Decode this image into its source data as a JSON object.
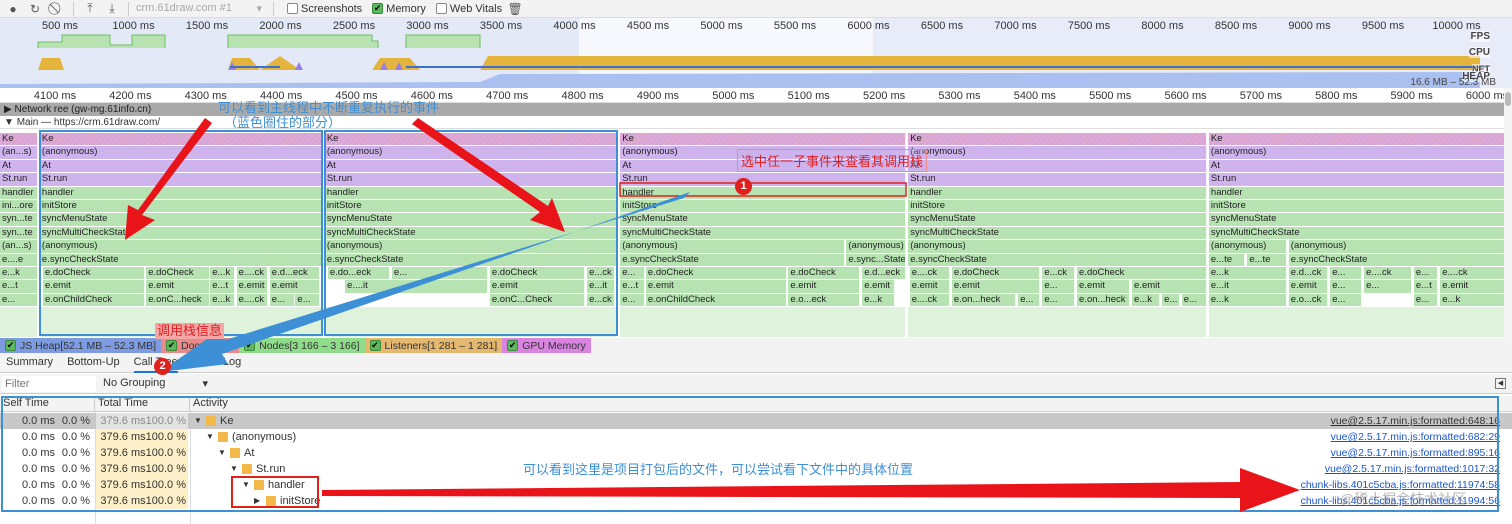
{
  "toolbar": {
    "icons": [
      "record-icon",
      "reload-icon",
      "clear-icon",
      "upload-icon",
      "download-icon"
    ],
    "target": "crm.61draw.com #1",
    "screenshots_label": "Screenshots",
    "screenshots_checked": false,
    "memory_label": "Memory",
    "memory_checked": true,
    "webvitals_label": "Web Vitals",
    "webvitals_checked": false
  },
  "overview": {
    "ticks": [
      "500 ms",
      "1000 ms",
      "1500 ms",
      "2000 ms",
      "2500 ms",
      "3000 ms",
      "3500 ms",
      "4000 ms",
      "4500 ms",
      "5000 ms",
      "5500 ms",
      "6000 ms",
      "6500 ms",
      "7000 ms",
      "7500 ms",
      "8000 ms",
      "8500 ms",
      "9000 ms",
      "9500 ms",
      "10000 ms"
    ],
    "tick_ms": [
      500,
      1000,
      1500,
      2000,
      2500,
      3000,
      3500,
      4000,
      4500,
      5000,
      5500,
      6000,
      6500,
      7000,
      7500,
      8000,
      8500,
      9000,
      9500,
      10000
    ],
    "labels": {
      "fps": "FPS",
      "cpu": "CPU",
      "net": "NET",
      "heap": "HEAP"
    },
    "heap_range": "16.6 MB – 52.3 MB",
    "selection_ms": [
      4030,
      6030
    ],
    "colors": {
      "fps": "#b8e3b0",
      "cpu_scripting": "#e4b43c",
      "cpu_rendering": "#9b7ee0",
      "net": "#3d6fd0",
      "heap": "#a9c0f0"
    }
  },
  "ruler": {
    "ticks": [
      "4100 ms",
      "4200 ms",
      "4300 ms",
      "4400 ms",
      "4500 ms",
      "4600 ms",
      "4700 ms",
      "4800 ms",
      "4900 ms",
      "5000 ms",
      "5100 ms",
      "5200 ms",
      "5300 ms",
      "5400 ms",
      "5500 ms",
      "5600 ms",
      "5700 ms",
      "5800 ms",
      "5900 ms",
      "6000 ms"
    ],
    "tick_ms": [
      4100,
      4200,
      4300,
      4400,
      4500,
      4600,
      4700,
      4800,
      4900,
      5000,
      5100,
      5200,
      5300,
      5400,
      5500,
      5600,
      5700,
      5800,
      5900,
      6000
    ]
  },
  "tracks": {
    "network": "Network ree (gw-mg.61info.cn)",
    "main": "Main — https://crm.61draw.com/"
  },
  "flame": {
    "groups": [
      {
        "start": 4027,
        "end": 4078,
        "rows": [
          "Ke",
          "(an...s)",
          "At",
          "St.run",
          "handler",
          "ini...ore",
          "syn...te",
          "syn...te",
          "(an...s)",
          "e....e"
        ],
        "lower": [
          [
            [
              "e...k",
              4027,
              4078
            ]
          ],
          [
            [
              "e...t",
              4027,
              4078
            ]
          ],
          [
            [
              "e...",
              4027,
              4078
            ]
          ]
        ]
      },
      {
        "start": 4080,
        "end": 4454,
        "rows": [
          "Ke",
          "(anonymous)",
          "At",
          "St.run",
          "handler",
          "initStore",
          "syncMenuState",
          "syncMultiCheckState",
          "(anonymous)",
          "e.syncCheckState"
        ],
        "lower": [
          [
            [
              "e.doCheck",
              4084,
              4219
            ],
            [
              "e.doCheck",
              4221,
              4306
            ],
            [
              "e...k",
              4306,
              4339
            ],
            [
              "e....ck",
              4341,
              4383
            ],
            [
              "e.d...eck",
              4385,
              4452
            ]
          ],
          [
            [
              "e.emit",
              4084,
              4219
            ],
            [
              "e.emit",
              4221,
              4306
            ],
            [
              "e...t",
              4306,
              4339
            ],
            [
              "e.emit",
              4341,
              4383
            ],
            [
              "e.emit",
              4385,
              4452
            ]
          ],
          [
            [
              "e.onChildCheck",
              4084,
              4219
            ],
            [
              "e.onC...heck",
              4221,
              4306
            ],
            [
              "e...k",
              4306,
              4339
            ],
            [
              "e....ck",
              4341,
              4383
            ],
            [
              "e...",
              4385,
              4418
            ],
            [
              "e...",
              4419,
              4452
            ]
          ]
        ]
      },
      {
        "start": 4458,
        "end": 4846,
        "rows": [
          "Ke",
          "(anonymous)",
          "At",
          "St.run",
          "handler",
          "initStore",
          "syncMenuState",
          "syncMultiCheckState",
          "(anonymous)",
          "e.syncCheckState"
        ],
        "lower": [
          [
            [
              "e.do...eck",
              4462,
              4544
            ],
            [
              "e...",
              4547,
              4674
            ],
            [
              "e.doCheck",
              4677,
              4803
            ],
            [
              "e...ck",
              4806,
              4843
            ]
          ],
          [
            [
              "e....it",
              4485,
              4674
            ],
            [
              "e.emit",
              4677,
              4803
            ],
            [
              "e...it",
              4806,
              4843
            ]
          ],
          [
            [
              "e.onC...Check",
              4677,
              4803
            ],
            [
              "e...ck",
              4806,
              4843
            ]
          ]
        ]
      },
      {
        "start": 4850,
        "end": 5229,
        "rows": [
          "Ke",
          "(anonymous)",
          "At",
          "St.run",
          "handler",
          "initStore",
          "syncMenuState",
          "syncMultiCheckState"
        ],
        "mid": [
          [
            [
              "(anonymous)",
              4850,
              5148
            ],
            [
              "(anonymous)",
              5150,
              5229
            ]
          ],
          [
            [
              "e.syncCheckState",
              4850,
              5148
            ],
            [
              "e.sync...State",
              5150,
              5229
            ]
          ]
        ],
        "lower": [
          [
            [
              "e...",
              4850,
              4883
            ],
            [
              "e.doCheck",
              4884,
              5071
            ],
            [
              "e.doCheck",
              5073,
              5168
            ],
            [
              "e.d...eck",
              5171,
              5229
            ]
          ],
          [
            [
              "e...t",
              4850,
              4883
            ],
            [
              "e.emit",
              4884,
              5071
            ],
            [
              "e.emit",
              5073,
              5168
            ],
            [
              "e.emit",
              5171,
              5215
            ]
          ],
          [
            [
              "e...",
              4850,
              4883
            ],
            [
              "e.onChildCheck",
              4884,
              5071
            ],
            [
              "e.o...eck",
              5073,
              5168
            ],
            [
              "e...k",
              5171,
              5215
            ]
          ]
        ]
      },
      {
        "start": 5232,
        "end": 5628,
        "rows": [
          "Ke",
          "(anonymous)",
          "At",
          "St.run",
          "handler",
          "initStore",
          "syncMenuState",
          "syncMultiCheckState",
          "(anonymous)",
          "e.syncCheckState"
        ],
        "lower": [
          [
            [
              "e....ck",
              5234,
              5287
            ],
            [
              "e.doCheck",
              5290,
              5407
            ],
            [
              "e...ck",
              5410,
              5453
            ],
            [
              "e.doCheck",
              5456,
              5628
            ]
          ],
          [
            [
              "e.emit",
              5234,
              5287
            ],
            [
              "e.emit",
              5290,
              5407
            ],
            [
              "e...",
              5410,
              5453
            ],
            [
              "e.emit",
              5456,
              5526
            ],
            [
              "e.emit",
              5529,
              5628
            ]
          ],
          [
            [
              "e....ck",
              5234,
              5287
            ],
            [
              "e.on...heck",
              5290,
              5375
            ],
            [
              "e...",
              5378,
              5407
            ],
            [
              "e...",
              5410,
              5453
            ],
            [
              "e.on...heck",
              5456,
              5526
            ],
            [
              "e...k",
              5529,
              5566
            ],
            [
              "e...",
              5569,
              5593
            ],
            [
              "e...",
              5595,
              5628
            ]
          ]
        ]
      },
      {
        "start": 5631,
        "end": 6033,
        "rows": [
          "Ke",
          "(anonymous)",
          "At",
          "St.run",
          "handler",
          "initStore",
          "syncMenuState",
          "syncMultiCheckState"
        ],
        "mid": [
          [
            [
              "(anonymous)",
              5631,
              5735
            ],
            [
              "(anonymous)",
              5737,
              6033
            ]
          ],
          [
            [
              "e...te",
              5631,
              5679
            ],
            [
              "e...te",
              5682,
              5735
            ],
            [
              "e.syncCheckState",
              5737,
              6033
            ]
          ]
        ],
        "lower": [
          [
            [
              "e...k",
              5631,
              5735
            ],
            [
              "e.d...ck",
              5737,
              5789
            ],
            [
              "e...",
              5792,
              5834
            ],
            [
              "e....ck",
              5837,
              5900
            ],
            [
              "e...",
              5903,
              5935
            ],
            [
              "e....ck",
              5938,
              6033
            ]
          ],
          [
            [
              "e...it",
              5631,
              5735
            ],
            [
              "e.emit",
              5737,
              5789
            ],
            [
              "e...",
              5792,
              5834
            ],
            [
              "e...",
              5837,
              5900
            ],
            [
              "e...t",
              5903,
              5935
            ],
            [
              "e.emit",
              5938,
              6033
            ]
          ],
          [
            [
              "e...k",
              5631,
              5735
            ],
            [
              "e.o...ck",
              5737,
              5789
            ],
            [
              "e...",
              5792,
              5834
            ],
            [
              "e...",
              5903,
              5935
            ],
            [
              "e...k",
              5938,
              6033
            ]
          ]
        ]
      }
    ],
    "selected": {
      "group": 3,
      "row": 4,
      "label": "handler"
    }
  },
  "memory_counters": [
    {
      "label": "JS Heap[52.1 MB – 52.3 MB]",
      "color": "#7c9be0"
    },
    {
      "label": "Documents",
      "color": "#e88a8a"
    },
    {
      "label": "Nodes[3 166 – 3 166]",
      "color": "#8fdc8a"
    },
    {
      "label": "Listeners[1 281 – 1 281]",
      "color": "#e5b870"
    },
    {
      "label": "GPU Memory",
      "color": "#d884e0"
    }
  ],
  "tabs": [
    "Summary",
    "Bottom-Up",
    "Call Tree",
    "Event Log"
  ],
  "active_tab": "Call Tree",
  "filter": {
    "placeholder": "Filter",
    "grouping": "No Grouping"
  },
  "table": {
    "headers": [
      "Self Time",
      "Total Time",
      "Activity"
    ],
    "rows": [
      {
        "self": "0.0 ms",
        "self_pct": "0.0 %",
        "total": "379.6 ms100.0 %",
        "name": "Ke",
        "depth": 0,
        "expanded": true,
        "url": "vue@2.5.17.min.js:formatted:648:16"
      },
      {
        "self": "0.0 ms",
        "self_pct": "0.0 %",
        "total": "379.6 ms100.0 %",
        "name": "(anonymous)",
        "depth": 1,
        "expanded": true,
        "url": "vue@2.5.17.min.js:formatted:682:29"
      },
      {
        "self": "0.0 ms",
        "self_pct": "0.0 %",
        "total": "379.6 ms100.0 %",
        "name": "At",
        "depth": 2,
        "expanded": true,
        "url": "vue@2.5.17.min.js:formatted:895:16"
      },
      {
        "self": "0.0 ms",
        "self_pct": "0.0 %",
        "total": "379.6 ms100.0 %",
        "name": "St.run",
        "depth": 3,
        "expanded": true,
        "url": "vue@2.5.17.min.js:formatted:1017:32"
      },
      {
        "self": "0.0 ms",
        "self_pct": "0.0 %",
        "total": "379.6 ms100.0 %",
        "name": "handler",
        "depth": 4,
        "expanded": true,
        "url": "chunk-libs.401c5cba.js:formatted:11974:58"
      },
      {
        "self": "0.0 ms",
        "self_pct": "0.0 %",
        "total": "379.6 ms100.0 %",
        "name": "initStore",
        "depth": 5,
        "expanded": false,
        "url": "chunk-libs.401c5cba.js:formatted:11994:56"
      }
    ]
  },
  "annotations": {
    "main_thread_note": "可以看到主线程中不断重复执行的事件",
    "main_thread_note2": "（蓝色圈住的部分）",
    "select_note": "选中任一子事件来查看其调用栈",
    "stack_note": "调用栈信息",
    "bundle_note": "可以看到这里是项目打包后的文件，可以尝试看下文件中的具体位置",
    "badge1": "1",
    "badge2": "2",
    "watermark": "@稀土掘金技术社区",
    "colors": {
      "blue": "#3d8fd6",
      "red": "#e0201a"
    }
  }
}
